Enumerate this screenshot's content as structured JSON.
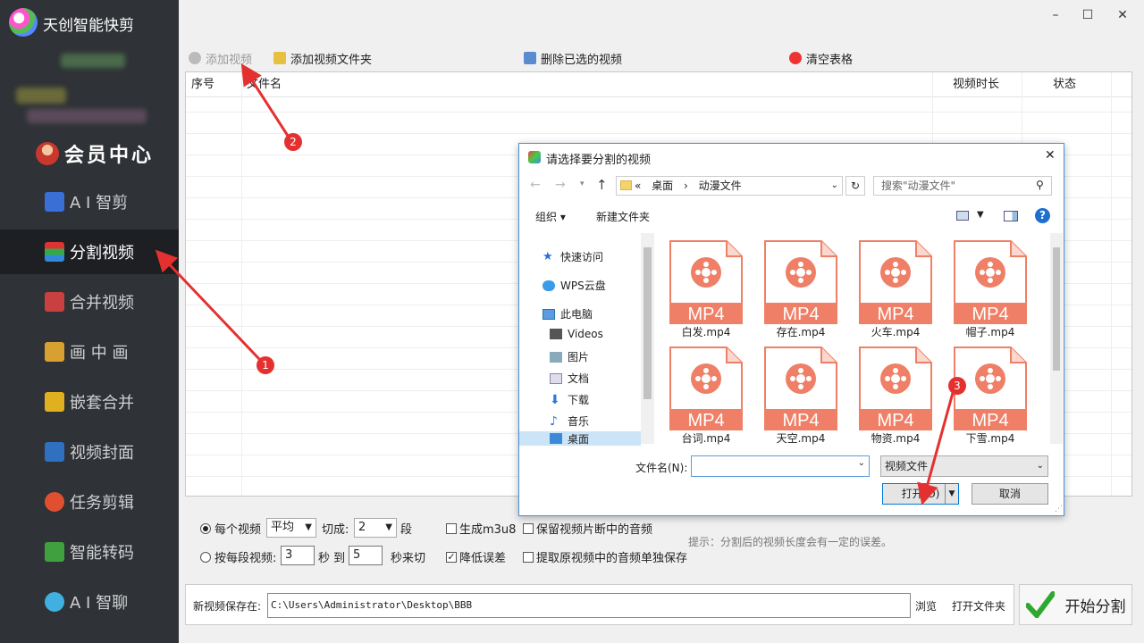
{
  "app": {
    "title": "天创智能快剪"
  },
  "sidebar": {
    "member": "会员中心",
    "items": [
      {
        "label": "A I 智剪",
        "icon": "wand-icon",
        "color": "#3b6fd8"
      },
      {
        "label": "分割视频",
        "icon": "split-video-icon",
        "color": "#3ba84a",
        "active": true
      },
      {
        "label": "合并视频",
        "icon": "merge-video-icon",
        "color": "#c84040"
      },
      {
        "label": "画 中 画",
        "icon": "pip-icon",
        "color": "#d8a030"
      },
      {
        "label": "嵌套合并",
        "icon": "nest-merge-icon",
        "color": "#e0b020"
      },
      {
        "label": "视频封面",
        "icon": "video-cover-icon",
        "color": "#3070c0"
      },
      {
        "label": "任务剪辑",
        "icon": "task-edit-icon",
        "color": "#e05030"
      },
      {
        "label": "智能转码",
        "icon": "transcode-icon",
        "color": "#40a040"
      },
      {
        "label": "A I 智聊",
        "icon": "chat-icon",
        "color": "#40b0e0"
      }
    ]
  },
  "window": {
    "minimize": "–",
    "maximize": "☐",
    "close": "✕"
  },
  "toolbar": {
    "add_video": "添加视频",
    "add_folder": "添加视频文件夹",
    "delete_selected": "删除已选的视频",
    "clear_table": "清空表格"
  },
  "table": {
    "columns": [
      "序号",
      "文件名",
      "视频时长",
      "状态"
    ]
  },
  "options": {
    "per_video_label": "每个视频",
    "mode_value": "平均",
    "cut_label": "切成:",
    "cut_count": "2",
    "segment_unit": "段",
    "gen_m3u8": "生成m3u8",
    "keep_audio": "保留视频片断中的音频",
    "by_segment_label": "按每段视频:",
    "seg_from": "3",
    "sec_to": "秒 到",
    "seg_to": "5",
    "sec_cut": "秒来切",
    "reduce_error": "降低误差",
    "extract_audio": "提取原视频中的音频单独保存",
    "hint": "提示：分割后的视频长度会有一定的误差。"
  },
  "save": {
    "label": "新视频保存在:",
    "path": "C:\\Users\\Administrator\\Desktop\\BBB",
    "browse": "浏览",
    "open_folder": "打开文件夹"
  },
  "start_button": "开始分割",
  "dialog": {
    "title": "请选择要分割的视频",
    "breadcrumb_prefix": "«",
    "crumb1": "桌面",
    "crumb_sep": "›",
    "crumb2": "动漫文件",
    "search_placeholder": "搜索\"动漫文件\"",
    "organize": "组织 ▾",
    "new_folder": "新建文件夹",
    "nav": [
      {
        "label": "快速访问",
        "icon": "star-icon"
      },
      {
        "label": "WPS云盘",
        "icon": "cloud-icon"
      },
      {
        "label": "此电脑",
        "icon": "computer-icon"
      },
      {
        "label": "Videos",
        "icon": "videos-folder-icon"
      },
      {
        "label": "图片",
        "icon": "pictures-folder-icon"
      },
      {
        "label": "文档",
        "icon": "documents-folder-icon"
      },
      {
        "label": "下载",
        "icon": "download-folder-icon"
      },
      {
        "label": "音乐",
        "icon": "music-folder-icon"
      },
      {
        "label": "桌面",
        "icon": "desktop-folder-icon"
      }
    ],
    "files": [
      {
        "name": "白发.mp4"
      },
      {
        "name": "存在.mp4"
      },
      {
        "name": "火车.mp4"
      },
      {
        "name": "帽子.mp4"
      },
      {
        "name": "台词.mp4"
      },
      {
        "name": "天空.mp4"
      },
      {
        "name": "物资.mp4"
      },
      {
        "name": "下雪.mp4"
      }
    ],
    "file_badge": "MP4",
    "filename_label": "文件名(N):",
    "filename_value": "",
    "filetype": "视频文件",
    "open": "打开(O)",
    "cancel": "取消"
  },
  "annotations": [
    "1",
    "2",
    "3"
  ],
  "colors": {
    "sidebar": "#2f3236",
    "accent_red": "#e53030",
    "mp4": "#ef7f66"
  }
}
